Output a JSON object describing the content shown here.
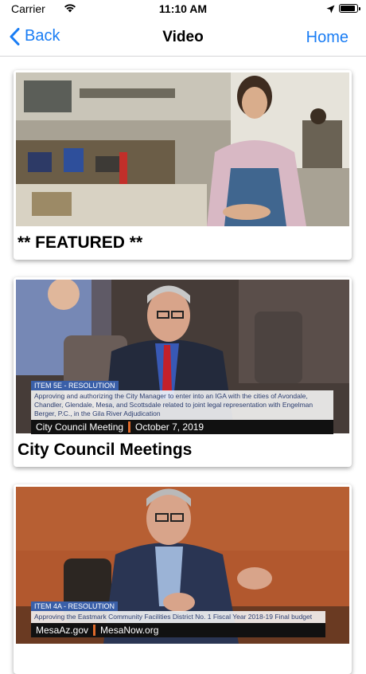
{
  "status_bar": {
    "carrier": "Carrier",
    "time": "11:10 AM",
    "battery_level": 0.9
  },
  "nav": {
    "back_label": "Back",
    "title": "Video",
    "home_label": "Home"
  },
  "cards": [
    {
      "title": "** FEATURED **"
    },
    {
      "title": "City Council Meetings",
      "overlay": {
        "tag": "ITEM 5E - RESOLUTION",
        "description": "Approving and authorizing the City Manager to enter into an IGA with the cities of Avondale, Chandler, Glendale, Mesa, and Scottsdale related to joint legal representation with Engelman Berger, P.C., in the Gila River Adjudication",
        "left": "City Council Meeting",
        "right": "October 7, 2019"
      }
    },
    {
      "title": "",
      "overlay": {
        "tag": "ITEM 4A - RESOLUTION",
        "description": "Approving the Eastmark Community Facilities District No. 1 Fiscal Year 2018-19 Final budget",
        "left": "MesaAz.gov",
        "right": "MesaNow.org"
      }
    }
  ],
  "colors": {
    "accent": "#1a7df4",
    "overlay_tag": "#3a5fa8",
    "overlay_separator": "#e06a2a"
  }
}
